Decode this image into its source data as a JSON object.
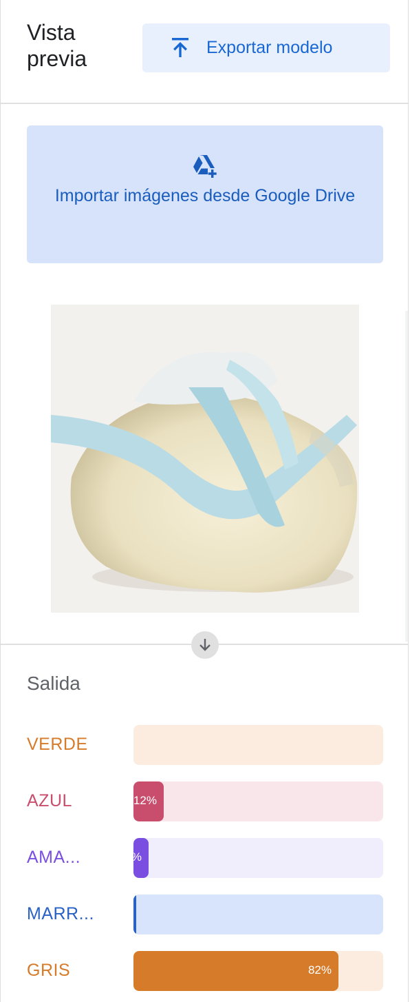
{
  "header": {
    "title": "Vista previa",
    "export_label": "Exportar modelo"
  },
  "import": {
    "label": "Importar imágenes desde Google Drive"
  },
  "output": {
    "heading": "Salida",
    "classes": [
      {
        "label": "VERDE",
        "percent": 0,
        "pct_text": "",
        "color": "#d67b2a",
        "track": "#fcece0"
      },
      {
        "label": "AZUL",
        "percent": 12,
        "pct_text": "12%",
        "color": "#c94e6d",
        "track": "#f9e6ea"
      },
      {
        "label": "AMA...",
        "percent": 6,
        "pct_text": "%",
        "color": "#7a4ee0",
        "track": "#f0edfd"
      },
      {
        "label": "MARR...",
        "percent": 1,
        "pct_text": "",
        "color": "#2a61c4",
        "track": "#d7e4fb"
      },
      {
        "label": "GRIS",
        "percent": 82,
        "pct_text": "82%",
        "color": "#d67b2a",
        "track": "#fcece0"
      }
    ]
  },
  "icons": {
    "export": "upload-icon",
    "drive": "google-drive-add-icon",
    "arrow": "arrow-down-icon"
  }
}
